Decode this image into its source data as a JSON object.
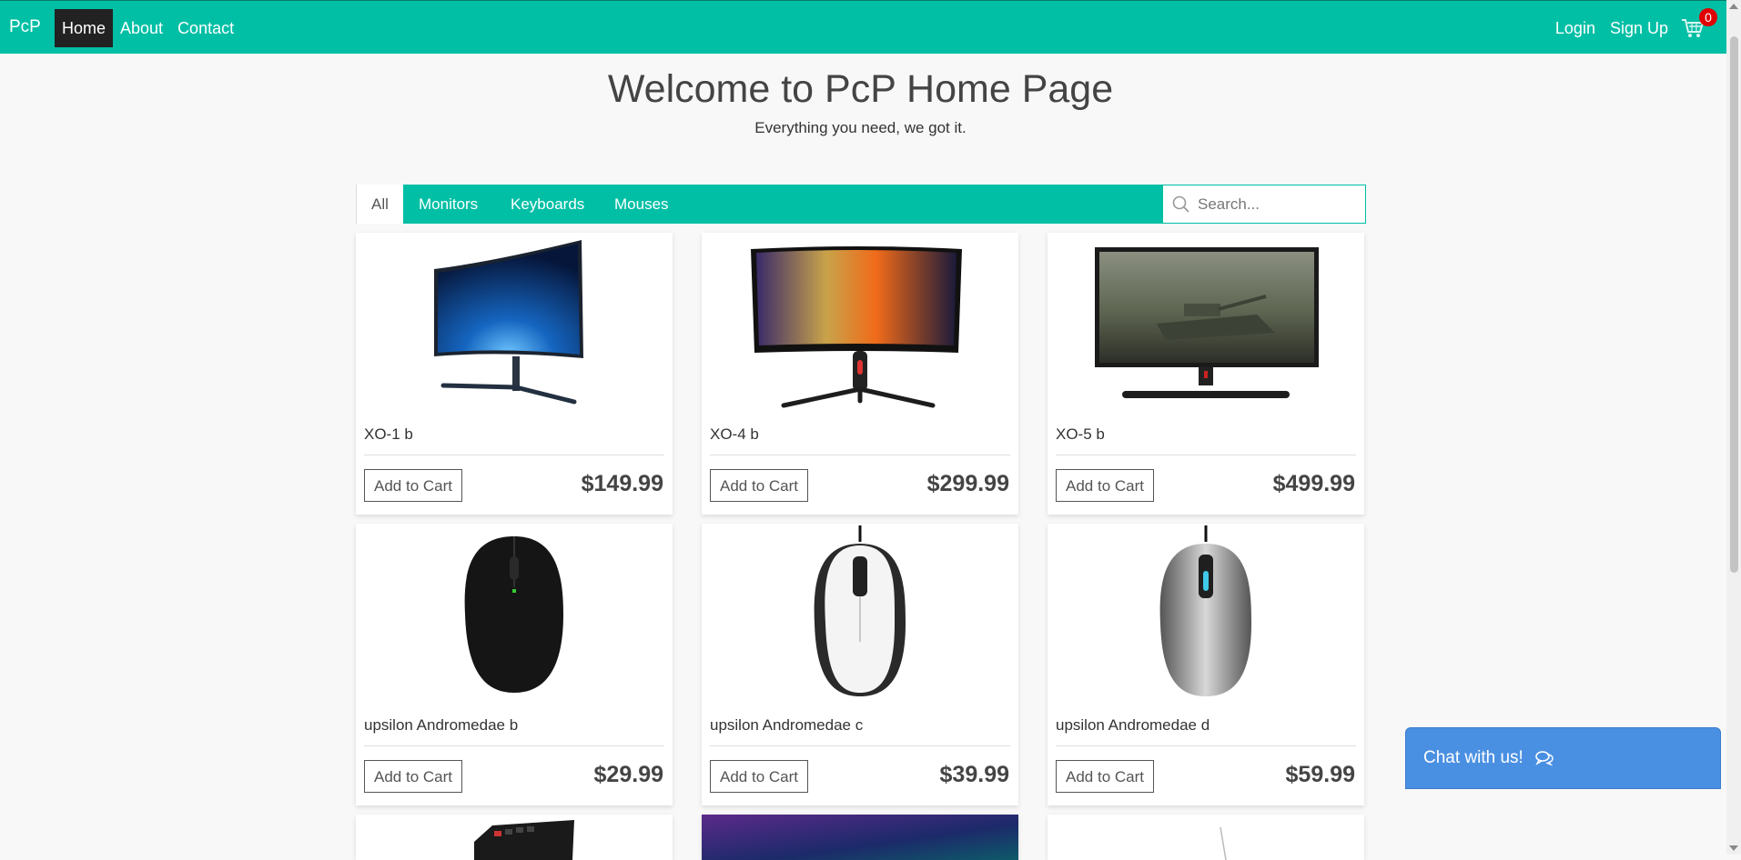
{
  "nav": {
    "brand": "PcP",
    "links": [
      "Home",
      "About",
      "Contact"
    ],
    "login": "Login",
    "signup": "Sign Up",
    "cart_count": "0"
  },
  "hero": {
    "title": "Welcome to PcP Home Page",
    "subtitle": "Everything you need, we got it."
  },
  "filters": {
    "tabs": [
      "All",
      "Monitors",
      "Keyboards",
      "Mouses"
    ],
    "active": "All",
    "search_placeholder": "Search..."
  },
  "products": [
    {
      "name": "XO-1 b",
      "price": "$149.99",
      "button": "Add to Cart",
      "icon": "curved-monitor-image"
    },
    {
      "name": "XO-4 b",
      "price": "$299.99",
      "button": "Add to Cart",
      "icon": "gaming-monitor-image"
    },
    {
      "name": "XO-5 b",
      "price": "$499.99",
      "button": "Add to Cart",
      "icon": "tank-monitor-image"
    },
    {
      "name": "upsilon Andromedae b",
      "price": "$29.99",
      "button": "Add to Cart",
      "icon": "black-mouse-image"
    },
    {
      "name": "upsilon Andromedae c",
      "price": "$39.99",
      "button": "Add to Cart",
      "icon": "white-mouse-image"
    },
    {
      "name": "upsilon Andromedae d",
      "price": "$59.99",
      "button": "Add to Cart",
      "icon": "silver-mouse-image"
    }
  ],
  "chat": {
    "label": "Chat with us!"
  },
  "colors": {
    "accent": "#00bfa5",
    "chat": "#4a90e2",
    "badge": "#e00000"
  }
}
